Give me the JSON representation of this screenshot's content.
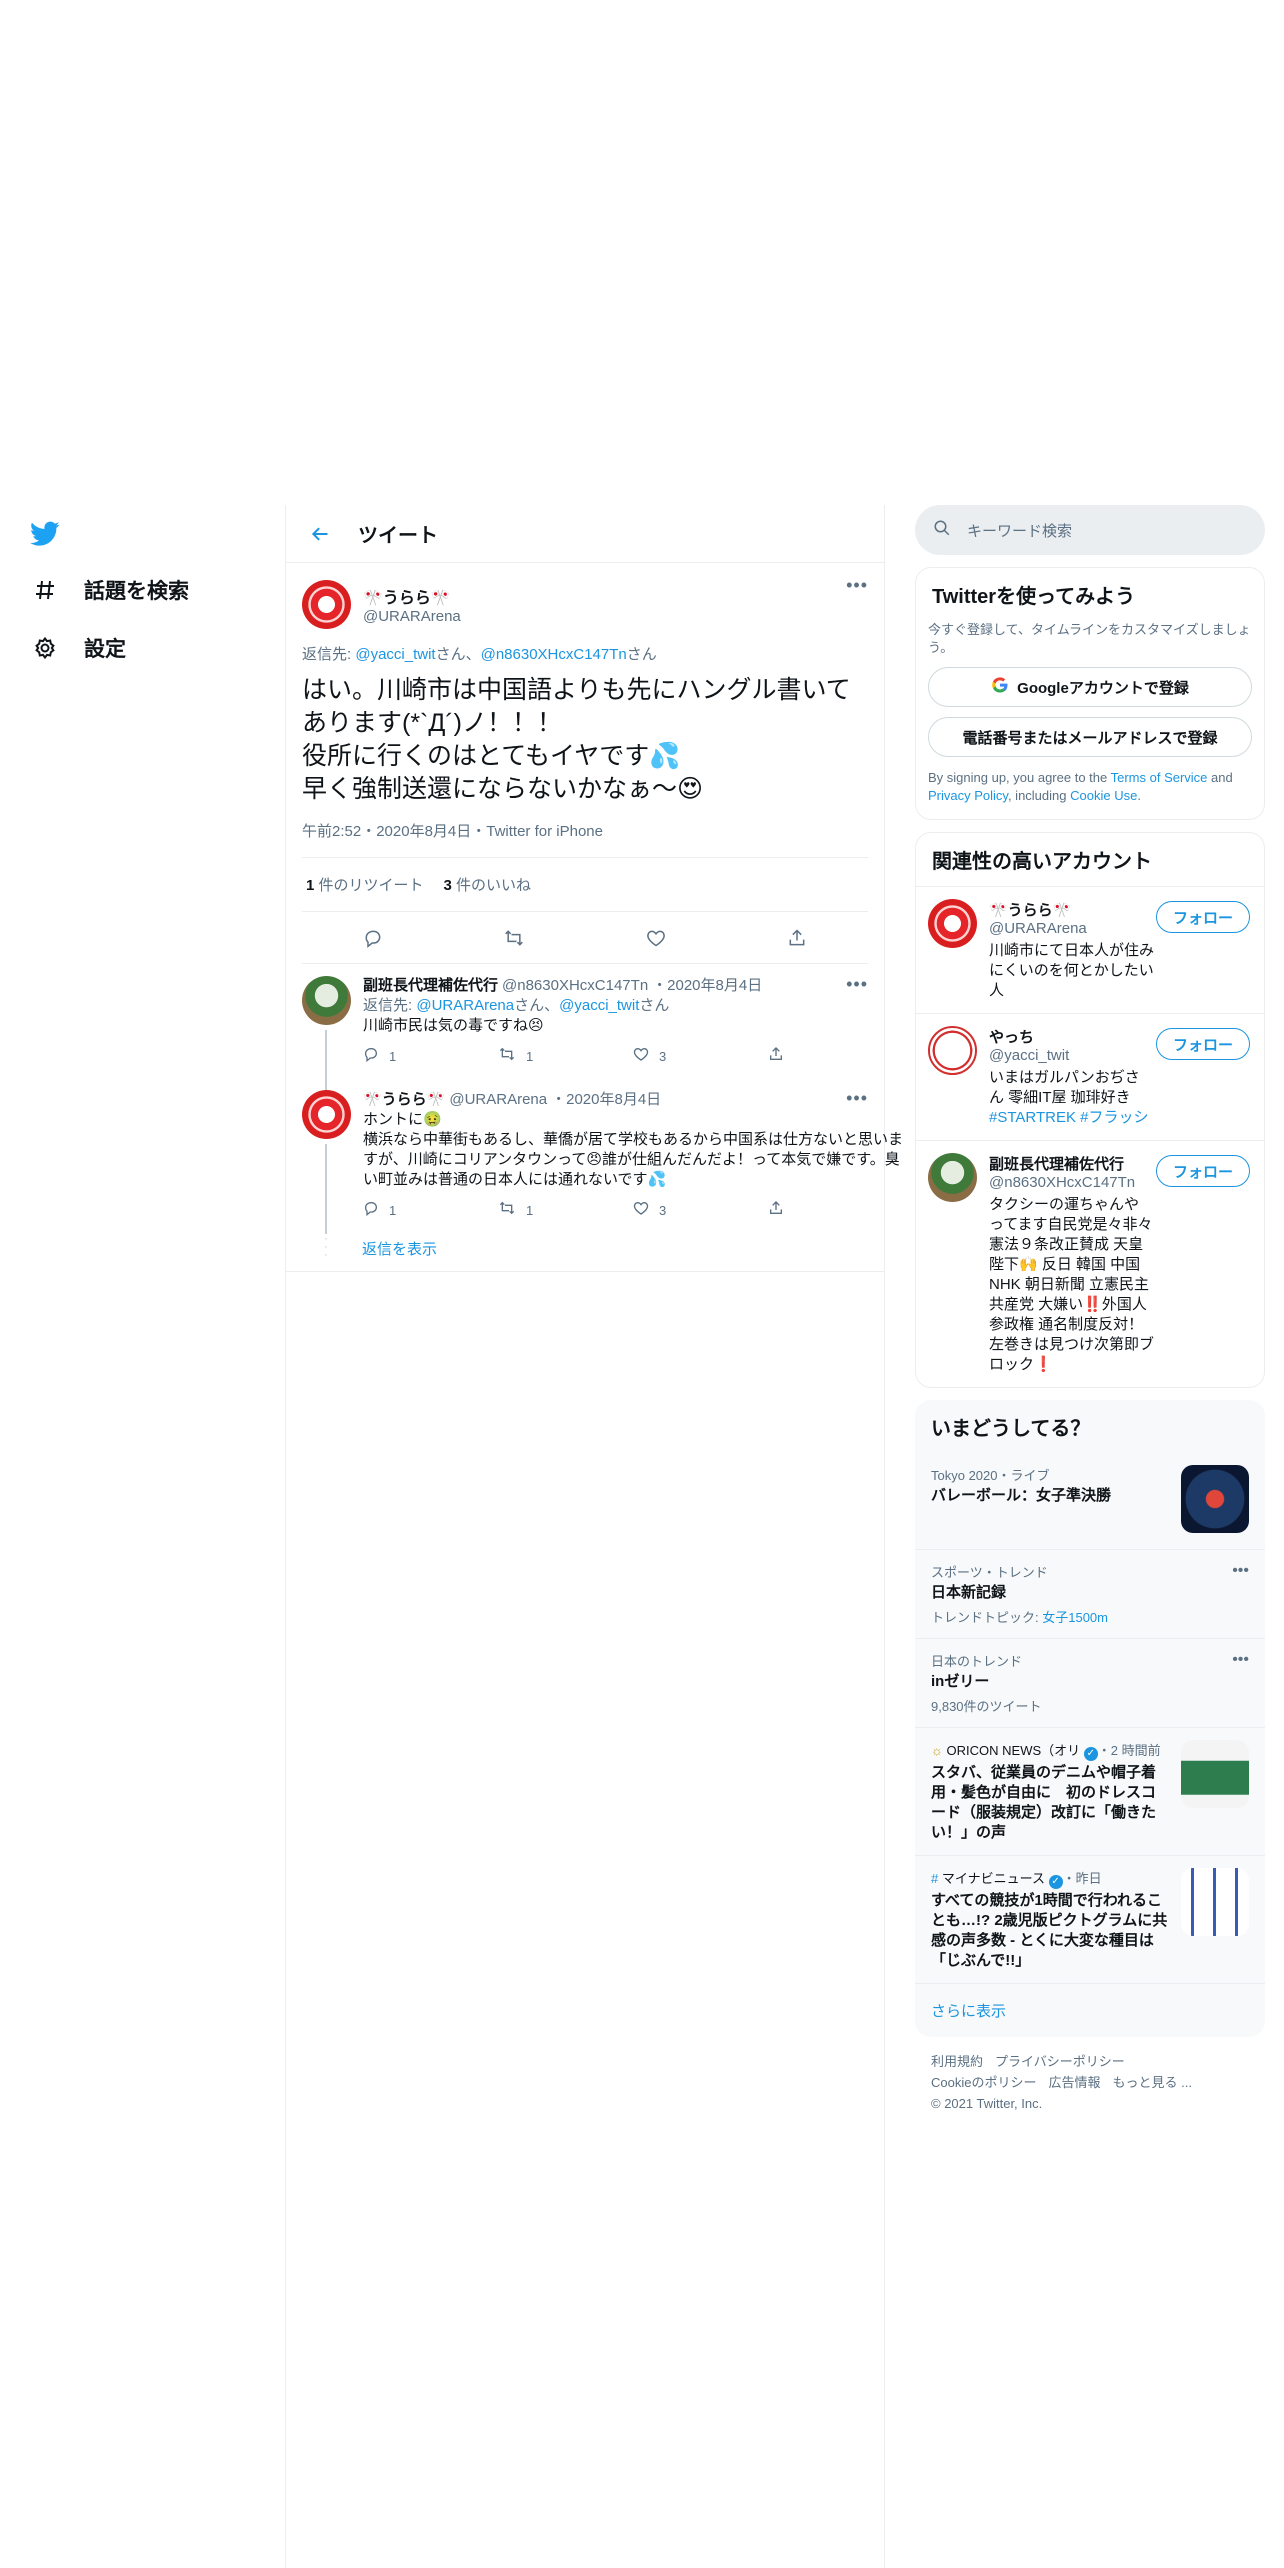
{
  "nav": {
    "explore_label": "話題を検索",
    "settings_label": "設定"
  },
  "header": {
    "title": "ツイート"
  },
  "main_tweet": {
    "name": "🎌うらら🎌",
    "handle": "@URARArena",
    "reply_prefix": "返信先: ",
    "reply_to_1": "@yacci_twit",
    "reply_mid": "さん、",
    "reply_to_2": "@n8630XHcxC147Tn",
    "reply_suffix": "さん",
    "text": "はい。川崎市は中国語よりも先にハングル書いてあります(*`Д´)ノ！！！\n役所に行くのはとてもイヤです💦\n早く強制送還にならないかなぁ〜😍",
    "timestamp": "午前2:52・2020年8月4日・Twitter for iPhone",
    "retweets_count": "1",
    "retweets_label": " 件のリツイート",
    "likes_count": "3",
    "likes_label": " 件のいいね"
  },
  "replies": [
    {
      "name": "副班長代理補佐代行",
      "handle": "@n8630XHcxC147Tn",
      "date": "・2020年8月4日",
      "reply_prefix": "返信先: ",
      "reply_to_1": "@URARArena",
      "reply_mid": "さん、",
      "reply_to_2": "@yacci_twit",
      "reply_suffix": "さん",
      "text": "川崎市民は気の毒ですね😣",
      "reply_count": "1",
      "retweet_count": "1",
      "like_count": "3"
    },
    {
      "name": "🎌うらら🎌",
      "handle": "@URARArena",
      "date": "・2020年8月4日",
      "text": "ホントに🤢\n横浜なら中華街もあるし、華僑が居て学校もあるから中国系は仕方ないと思いますが、川崎にコリアンタウンって😠誰が仕組んだんだよ！って本気で嫌です。臭い町並みは普通の日本人には通れないです💦",
      "reply_count": "1",
      "retweet_count": "1",
      "like_count": "3"
    }
  ],
  "show_replies": "返信を表示",
  "search": {
    "placeholder": "キーワード検索"
  },
  "signup": {
    "title": "Twitterを使ってみよう",
    "desc": "今すぐ登録して、タイムラインをカスタマイズしましょう。",
    "google_button": "Googleアカウントで登録",
    "phone_button": "電話番号またはメールアドレスで登録",
    "legal_1": "By signing up, you agree to the ",
    "legal_terms": "Terms of Service",
    "legal_2": " and ",
    "legal_privacy": "Privacy Policy",
    "legal_3": ", including ",
    "legal_cookie": "Cookie Use",
    "legal_4": "."
  },
  "related": {
    "title": "関連性の高いアカウント",
    "follow_label": "フォロー",
    "accounts": [
      {
        "name": "🎌うらら🎌",
        "handle": "@URARArena",
        "bio": "川崎市にて日本人が住みにくいのを何とかしたい人"
      },
      {
        "name": "やっち",
        "handle": "@yacci_twit",
        "bio_prefix": "いまはガルパンおぢさん 零細IT屋 珈琲好き ",
        "bio_tags": "#STARTREK #フラッシュライト #柴巻 #クロスバイク #ロードバイク #筆記具 #ガスガン #ねんどろいど"
      },
      {
        "name": "副班長代理補佐代行",
        "handle": "@n8630XHcxC147Tn",
        "bio": "タクシーの運ちゃんやってます自民党是々非々 憲法９条改正賛成 天皇陛下🙌 反日 韓国 中国 NHK 朝日新聞 立憲民主 共産党 大嫌い‼️外国人参政権 通名制度反対！左巻きは見つけ次第即ブロック❗"
      }
    ]
  },
  "trends": {
    "title": "いまどうしてる？",
    "items": [
      {
        "context": "Tokyo 2020・ライブ",
        "title": "バレーボール：女子準決勝"
      },
      {
        "context": "スポーツ・トレンド",
        "title": "日本新記録",
        "sub_prefix": "トレンドトピック: ",
        "sub_link": "女子1500m"
      },
      {
        "context": "日本のトレンド",
        "title": "inゼリー",
        "sub": "9,830件のツイート"
      },
      {
        "context_source": "ORICON NEWS（オリ",
        "context_time": "・2 時間前",
        "title": "スタバ、従業員のデニムや帽子着用・髪色が自由に　初のドレスコード（服装規定）改訂に「働きたい！」の声"
      },
      {
        "context_source": "マイナビニュース",
        "context_time": "・昨日",
        "title": "すべての競技が1時間で行われることも…!? 2歳児版ピクトグラムに共感の声多数 - とくに大変な種目は「じぶんで!!」"
      }
    ],
    "show_more": "さらに表示"
  },
  "footer": {
    "terms": "利用規約",
    "privacy": "プライバシーポリシー",
    "cookie": "Cookieのポリシー",
    "ads": "広告情報",
    "more": "もっと見る ...",
    "copyright": "© 2021 Twitter, Inc."
  },
  "colors": {
    "accent": "#1b95e0",
    "secondary_text": "#5b7083",
    "border": "#ebeef0"
  },
  "icons": [
    "twitter-logo-icon",
    "hashtag-icon",
    "gear-icon",
    "back-arrow-icon",
    "more-icon",
    "reply-icon",
    "retweet-icon",
    "like-icon",
    "share-icon",
    "search-icon",
    "google-icon",
    "verified-icon"
  ]
}
